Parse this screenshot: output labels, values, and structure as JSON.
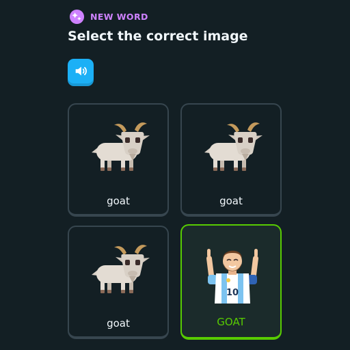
{
  "header": {
    "badge_label": "NEW WORD",
    "badge_icon": "sparkle-badge-icon",
    "badge_color": "#CE82FF",
    "prompt": "Select the correct image"
  },
  "audio_button": {
    "icon": "speaker-icon",
    "color": "#1CB0F6"
  },
  "choices": [
    {
      "label": "goat",
      "image": "goat-illustration",
      "selected": false
    },
    {
      "label": "goat",
      "image": "goat-illustration",
      "selected": false
    },
    {
      "label": "goat",
      "image": "goat-illustration",
      "selected": false
    },
    {
      "label": "GOAT",
      "image": "footballer-number-10-illustration",
      "selected": true
    }
  ],
  "colors": {
    "background": "#131F24",
    "card_border": "#37464F",
    "selected_border": "#58CC02",
    "text": "#F1F7FB"
  }
}
